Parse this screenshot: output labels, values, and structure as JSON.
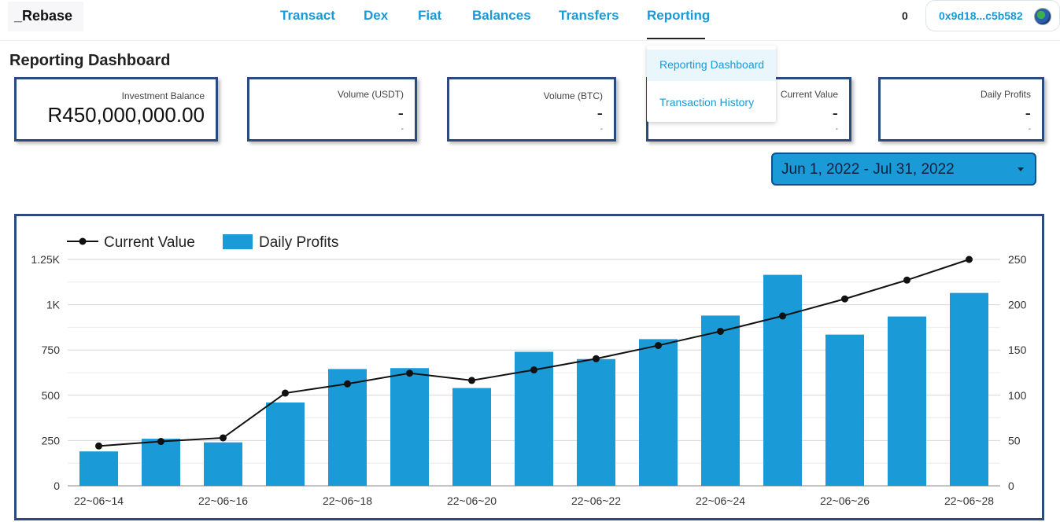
{
  "app": {
    "logo": "_Rebase"
  },
  "nav": [
    {
      "label": "Transact"
    },
    {
      "label": "Dex"
    },
    {
      "label": "Fiat"
    },
    {
      "label": "Balances"
    },
    {
      "label": "Transfers"
    },
    {
      "label": "Reporting"
    }
  ],
  "header": {
    "count": "0",
    "wallet": "0x9d18...c5b582",
    "wallet_icon": "wallet-avatar-icon"
  },
  "page": {
    "title": "Reporting Dashboard"
  },
  "cards": [
    {
      "label": "Investment Balance",
      "value": "R450,000,000.00",
      "sub": ""
    },
    {
      "label": "Volume (USDT)",
      "value": "-",
      "sub": "-"
    },
    {
      "label": "Volume (BTC)",
      "value": "-",
      "sub": "-"
    },
    {
      "label": "Current Value",
      "value": "-",
      "sub": "-"
    },
    {
      "label": "Daily Profits",
      "value": "-",
      "sub": "-"
    }
  ],
  "date_range": {
    "label": "Jun 1, 2022 - Jul 31, 2022"
  },
  "dropdown": {
    "items": [
      {
        "label": "Reporting Dashboard"
      },
      {
        "label": "Transaction History"
      }
    ]
  },
  "colors": {
    "accent": "#1a9ad6",
    "card_border": "#2c4a7e",
    "bar": "#1a9ad6",
    "line": "#111111"
  },
  "chart_data": {
    "type": "bar",
    "legend": [
      {
        "name": "Current Value"
      },
      {
        "name": "Daily Profits"
      }
    ],
    "legend_position": "top-left",
    "categories": [
      "22~06~14",
      "22~06~15",
      "22~06~16",
      "22~06~17",
      "22~06~18",
      "22~06~19",
      "22~06~20",
      "22~06~21",
      "22~06~22",
      "22~06~23",
      "22~06~24",
      "22~06~25",
      "22~06~26",
      "22~06~27",
      "22~06~28"
    ],
    "x_tick_labels": [
      "22~06~14",
      "22~06~16",
      "22~06~18",
      "22~06~20",
      "22~06~22",
      "22~06~24",
      "22~06~26",
      "22~06~28"
    ],
    "series": [
      {
        "name": "Daily Profits",
        "type": "bar",
        "axis": "right",
        "values": [
          38,
          52,
          48,
          92,
          129,
          130,
          108,
          148,
          140,
          162,
          188,
          233,
          167,
          187,
          213
        ]
      },
      {
        "name": "Current Value",
        "type": "line",
        "axis": "left",
        "values": [
          220,
          245,
          265,
          512,
          563,
          622,
          582,
          640,
          702,
          775,
          853,
          938,
          1032,
          1136,
          1250
        ]
      }
    ],
    "y_left": {
      "ticks": [
        "0",
        "250",
        "500",
        "750",
        "1K",
        "1.25K"
      ],
      "ylim": [
        0,
        1250
      ]
    },
    "y_right": {
      "ticks": [
        "0",
        "50",
        "100",
        "150",
        "200",
        "250"
      ],
      "ylim": [
        0,
        250
      ]
    },
    "grid": true
  }
}
